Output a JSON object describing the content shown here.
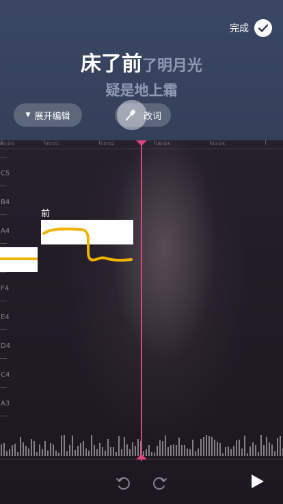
{
  "header": {
    "done_label": "完成",
    "lyric_line1_sung": "床了前",
    "lyric_line1_unsung": "了明月光",
    "lyric_line2": "疑是地上霜",
    "expand_label": "展开编辑",
    "edit_lyrics_label": "改词"
  },
  "ruler": {
    "tick_labels": [
      "00:00",
      "00:01",
      "00:02",
      "00:03",
      "00:04"
    ]
  },
  "pitch_labels": [
    "C5",
    "B4",
    "A4",
    "F4",
    "E4",
    "D4",
    "C4",
    "A3"
  ],
  "notes": {
    "active_lyric": "前"
  },
  "colors": {
    "header_bg": "#34405a",
    "playhead": "#e0457b",
    "pitch_curve": "#f0b400",
    "note_bar": "#ffffff"
  },
  "icons": {
    "done": "check-circle-icon",
    "expand": "triangle-down-icon",
    "edit": "microphone-icon",
    "undo": "undo-icon",
    "redo": "redo-icon",
    "play": "play-icon"
  }
}
